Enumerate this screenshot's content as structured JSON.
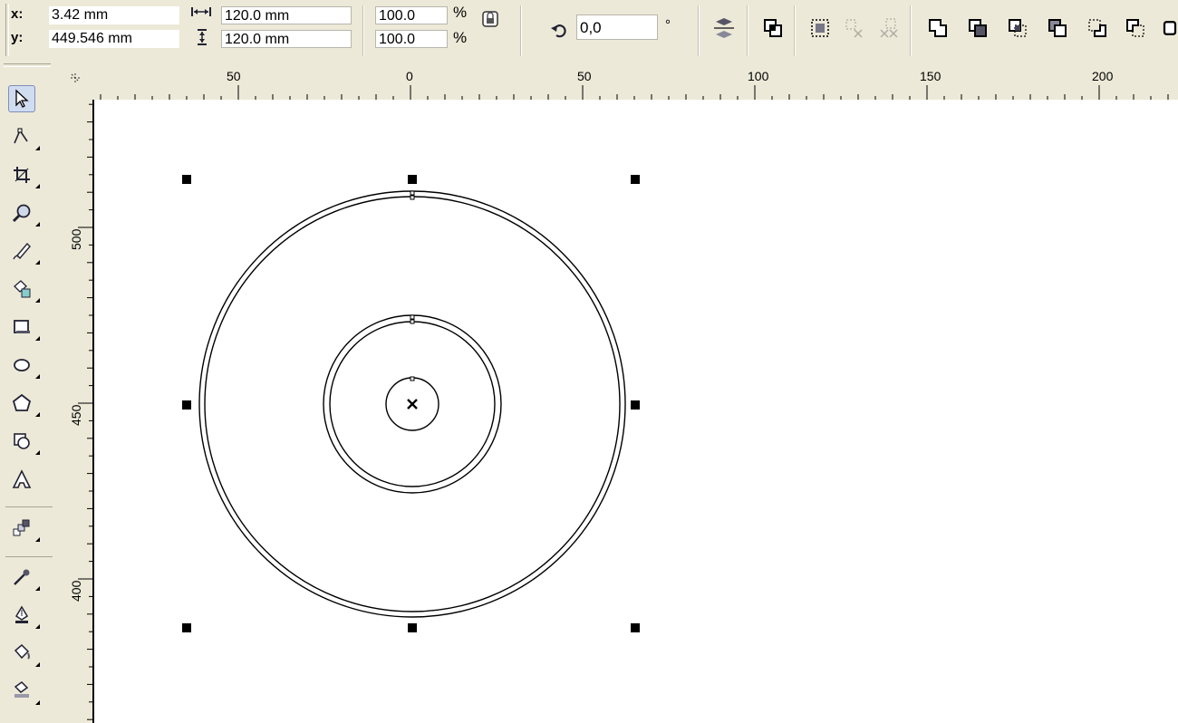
{
  "propbar": {
    "x_label": "x:",
    "x_value": "3.42 mm",
    "y_label": "y:",
    "y_value": "449.546 mm",
    "width_value": "120.0 mm",
    "height_value": "120.0 mm",
    "scale_x_value": "100.0",
    "scale_y_value": "100.0",
    "percent_symbol": "%",
    "rotation_value": "0,0",
    "degree_symbol": "°"
  },
  "rulers": {
    "horizontal_labels": [
      "50",
      "0",
      "50",
      "100",
      "150",
      "200"
    ],
    "vertical_labels": [
      "500",
      "450",
      "400"
    ]
  },
  "icons": {
    "lock_ratio": "lock-ratio-icon",
    "rotate": "rotate-icon",
    "mirror": "mirror-icon",
    "arrange": "arrange-icon"
  },
  "colors": {
    "panel": "#ece9d8",
    "canvas": "#ffffff",
    "handle": "#000000"
  }
}
